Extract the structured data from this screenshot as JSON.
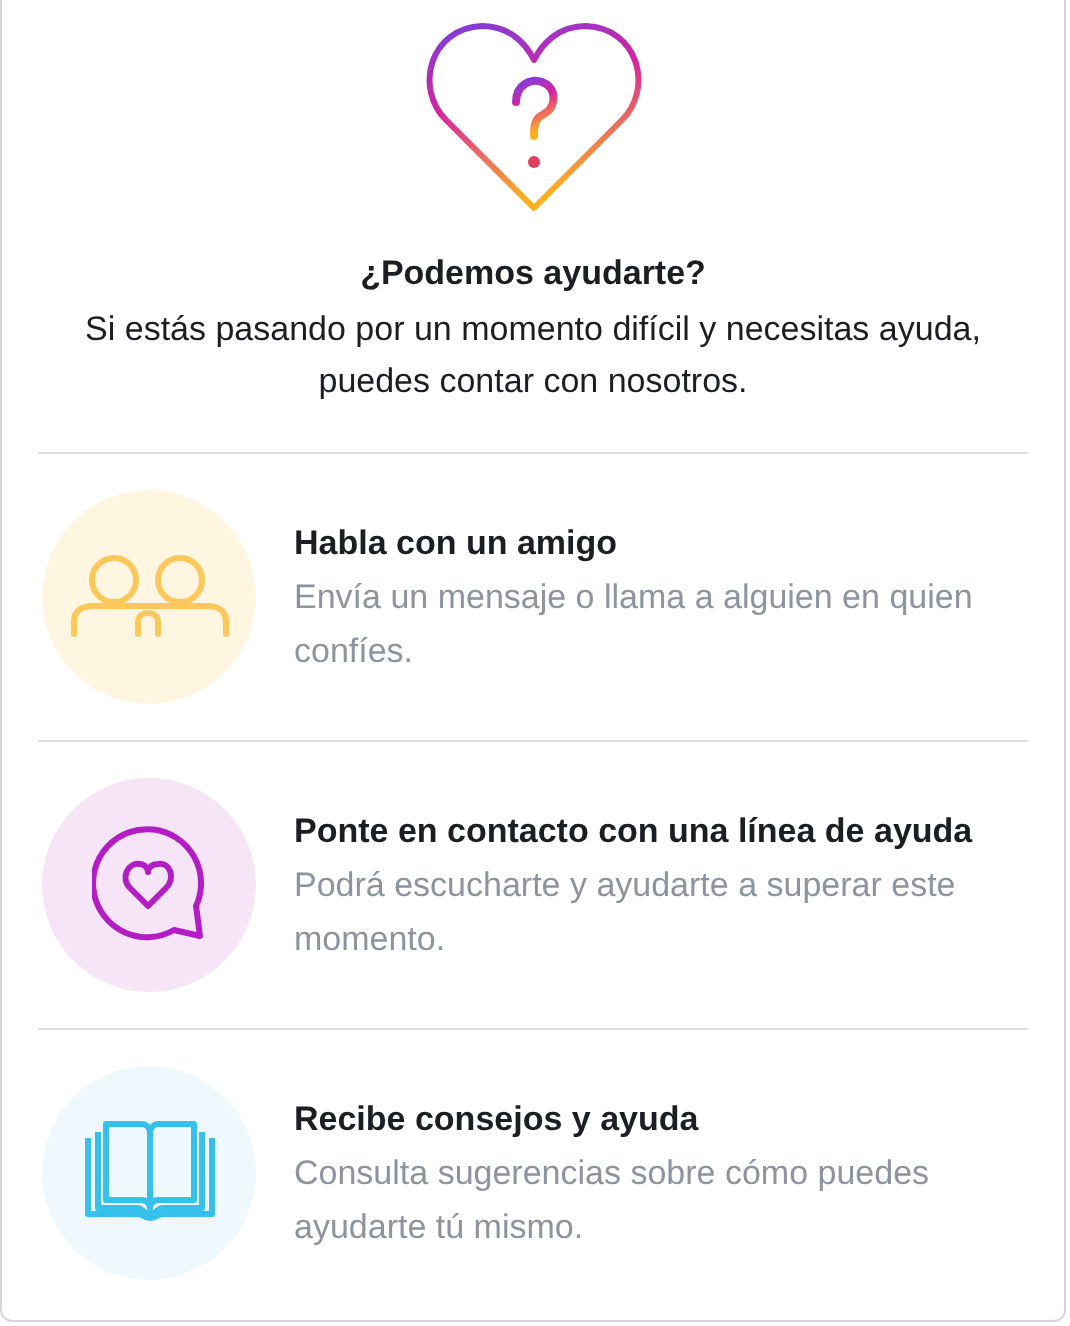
{
  "header": {
    "title": "¿Podemos ayudarte?",
    "text": "Si estás pasando por un momento difícil y necesitas ayuda, puedes contar con nosotros."
  },
  "options": [
    {
      "kind": "friends",
      "title": "Habla con un amigo",
      "text": "Envía un mensaje o llama a alguien en quien confíes."
    },
    {
      "kind": "helpline",
      "title": "Ponte en contacto con una línea de ayuda",
      "text": "Podrá escucharte y ayudarte a superar este momento."
    },
    {
      "kind": "tips",
      "title": "Recibe consejos y ayuda",
      "text": "Consulta sugerencias sobre cómo puedes ayudarte tú mismo."
    }
  ]
}
